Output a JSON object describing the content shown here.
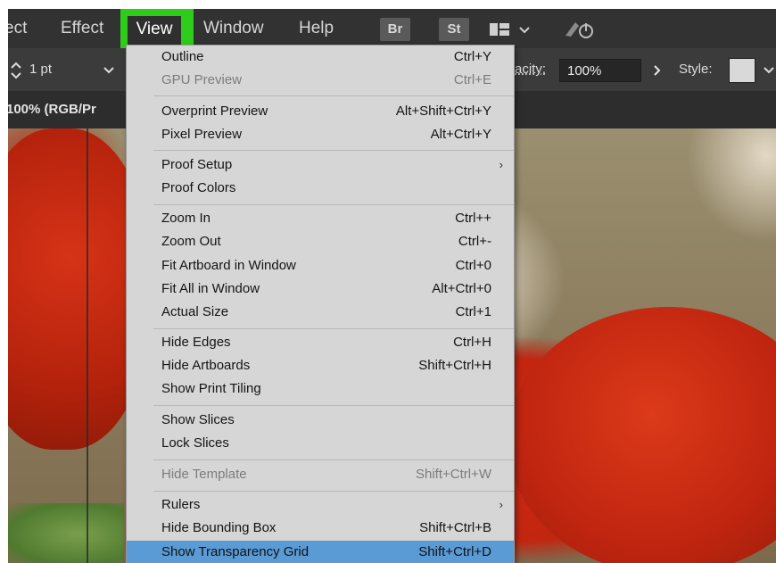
{
  "menubar": {
    "items": [
      {
        "label": "ect"
      },
      {
        "label": "Effect"
      },
      {
        "label": "View"
      },
      {
        "label": "Window"
      },
      {
        "label": "Help"
      }
    ],
    "badges": [
      "Br",
      "St"
    ]
  },
  "controlbar": {
    "stroke_weight": "1 pt",
    "opacity_label": "acity:",
    "opacity_value": "100%",
    "style_label": "Style:"
  },
  "document_tab": {
    "label": "100% (RGB/Pr"
  },
  "view_menu": {
    "items": [
      {
        "label": "Outline",
        "shortcut": "Ctrl+Y",
        "disabled": false
      },
      {
        "label": "GPU Preview",
        "shortcut": "Ctrl+E",
        "disabled": true
      },
      {
        "label": "Overprint Preview",
        "shortcut": "Alt+Shift+Ctrl+Y",
        "disabled": false
      },
      {
        "label": "Pixel Preview",
        "shortcut": "Alt+Ctrl+Y",
        "disabled": false
      },
      {
        "label": "Proof Setup",
        "shortcut": "",
        "submenu": true
      },
      {
        "label": "Proof Colors",
        "shortcut": ""
      },
      {
        "label": "Zoom In",
        "shortcut": "Ctrl++"
      },
      {
        "label": "Zoom Out",
        "shortcut": "Ctrl+-"
      },
      {
        "label": "Fit Artboard in Window",
        "shortcut": "Ctrl+0"
      },
      {
        "label": "Fit All in Window",
        "shortcut": "Alt+Ctrl+0"
      },
      {
        "label": "Actual Size",
        "shortcut": "Ctrl+1"
      },
      {
        "label": "Hide Edges",
        "shortcut": "Ctrl+H"
      },
      {
        "label": "Hide Artboards",
        "shortcut": "Shift+Ctrl+H"
      },
      {
        "label": "Show Print Tiling",
        "shortcut": ""
      },
      {
        "label": "Show Slices",
        "shortcut": ""
      },
      {
        "label": "Lock Slices",
        "shortcut": ""
      },
      {
        "label": "Hide Template",
        "shortcut": "Shift+Ctrl+W",
        "disabled": true
      },
      {
        "label": "Rulers",
        "shortcut": "",
        "submenu": true
      },
      {
        "label": "Hide Bounding Box",
        "shortcut": "Shift+Ctrl+B"
      },
      {
        "label": "Show Transparency Grid",
        "shortcut": "Shift+Ctrl+D",
        "highlighted": true
      }
    ],
    "highlight_color": "#5b9bd5"
  },
  "colors": {
    "menu_highlight_border": "#2ecc1b",
    "menubar_bg": "#323232",
    "dropdown_bg": "#d6d6d6"
  }
}
